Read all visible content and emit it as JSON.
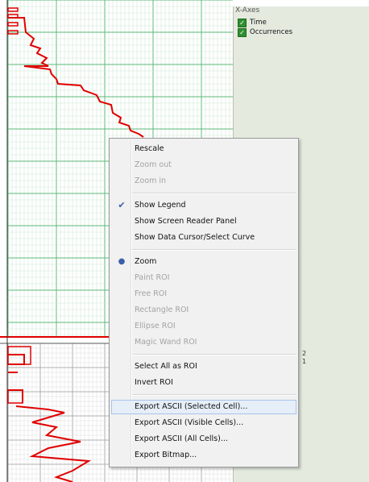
{
  "legend": {
    "title": "X-Axes",
    "items": [
      {
        "label": "Time",
        "checked": true
      },
      {
        "label": "Occurrences",
        "checked": true
      }
    ]
  },
  "bottom_panel": {
    "numbers": [
      "2",
      "1"
    ]
  },
  "context_menu": {
    "items": [
      {
        "label": "Rescale",
        "enabled": true
      },
      {
        "label": "Zoom out",
        "enabled": false
      },
      {
        "label": "Zoom in",
        "enabled": false
      },
      {
        "separator": true
      },
      {
        "label": "Show Legend",
        "enabled": true,
        "mark": "check"
      },
      {
        "label": "Show Screen Reader Panel",
        "enabled": true
      },
      {
        "label": "Show Data Cursor/Select Curve",
        "enabled": true
      },
      {
        "separator": true
      },
      {
        "label": "Zoom",
        "enabled": true,
        "mark": "radio"
      },
      {
        "label": "Paint ROI",
        "enabled": false
      },
      {
        "label": "Free ROI",
        "enabled": false
      },
      {
        "label": "Rectangle ROI",
        "enabled": false
      },
      {
        "label": "Ellipse ROI",
        "enabled": false
      },
      {
        "label": "Magic Wand ROI",
        "enabled": false
      },
      {
        "separator": true
      },
      {
        "label": "Select All as ROI",
        "enabled": true
      },
      {
        "label": "Invert ROI",
        "enabled": true
      },
      {
        "separator": true
      },
      {
        "label": "Export ASCII (Selected Cell)...",
        "enabled": true,
        "hovered": true
      },
      {
        "label": "Export ASCII (Visible Cells)...",
        "enabled": true
      },
      {
        "label": "Export ASCII (All Cells)...",
        "enabled": true
      },
      {
        "label": "Export Bitmap...",
        "enabled": true
      }
    ]
  },
  "colors": {
    "grid_major": "#5cb87a",
    "grid_minor": "#cfe8d6",
    "curve": "#e00000",
    "panel_bg": "#e5eadf",
    "menu_bg": "#f1f1f1",
    "check_icon": "#3a5fa8",
    "legend_check": "#2f8f2f"
  }
}
